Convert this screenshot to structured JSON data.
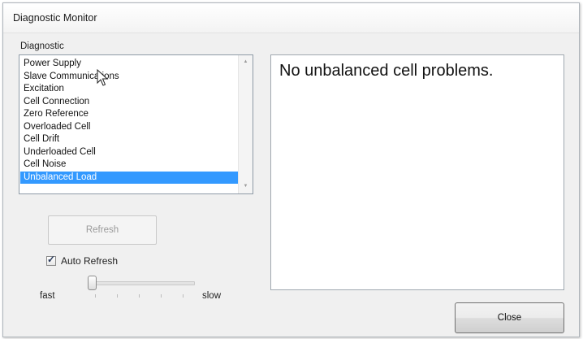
{
  "window": {
    "title": "Diagnostic Monitor"
  },
  "diagnostic": {
    "group_label": "Diagnostic",
    "items": [
      "Power Supply",
      "Slave Communications",
      "Excitation",
      "Cell Connection",
      "Zero Reference",
      "Overloaded Cell",
      "Cell Drift",
      "Underloaded Cell",
      "Cell Noise",
      "Unbalanced Load"
    ],
    "selected_item": "Unbalanced Load"
  },
  "controls": {
    "refresh_label": "Refresh",
    "auto_refresh_label": "Auto Refresh",
    "auto_refresh_checked": true,
    "slider_min_label": "fast",
    "slider_max_label": "slow",
    "slider_value_fraction": 0.0
  },
  "message": {
    "text": "No unbalanced cell problems."
  },
  "close_label": "Close"
}
